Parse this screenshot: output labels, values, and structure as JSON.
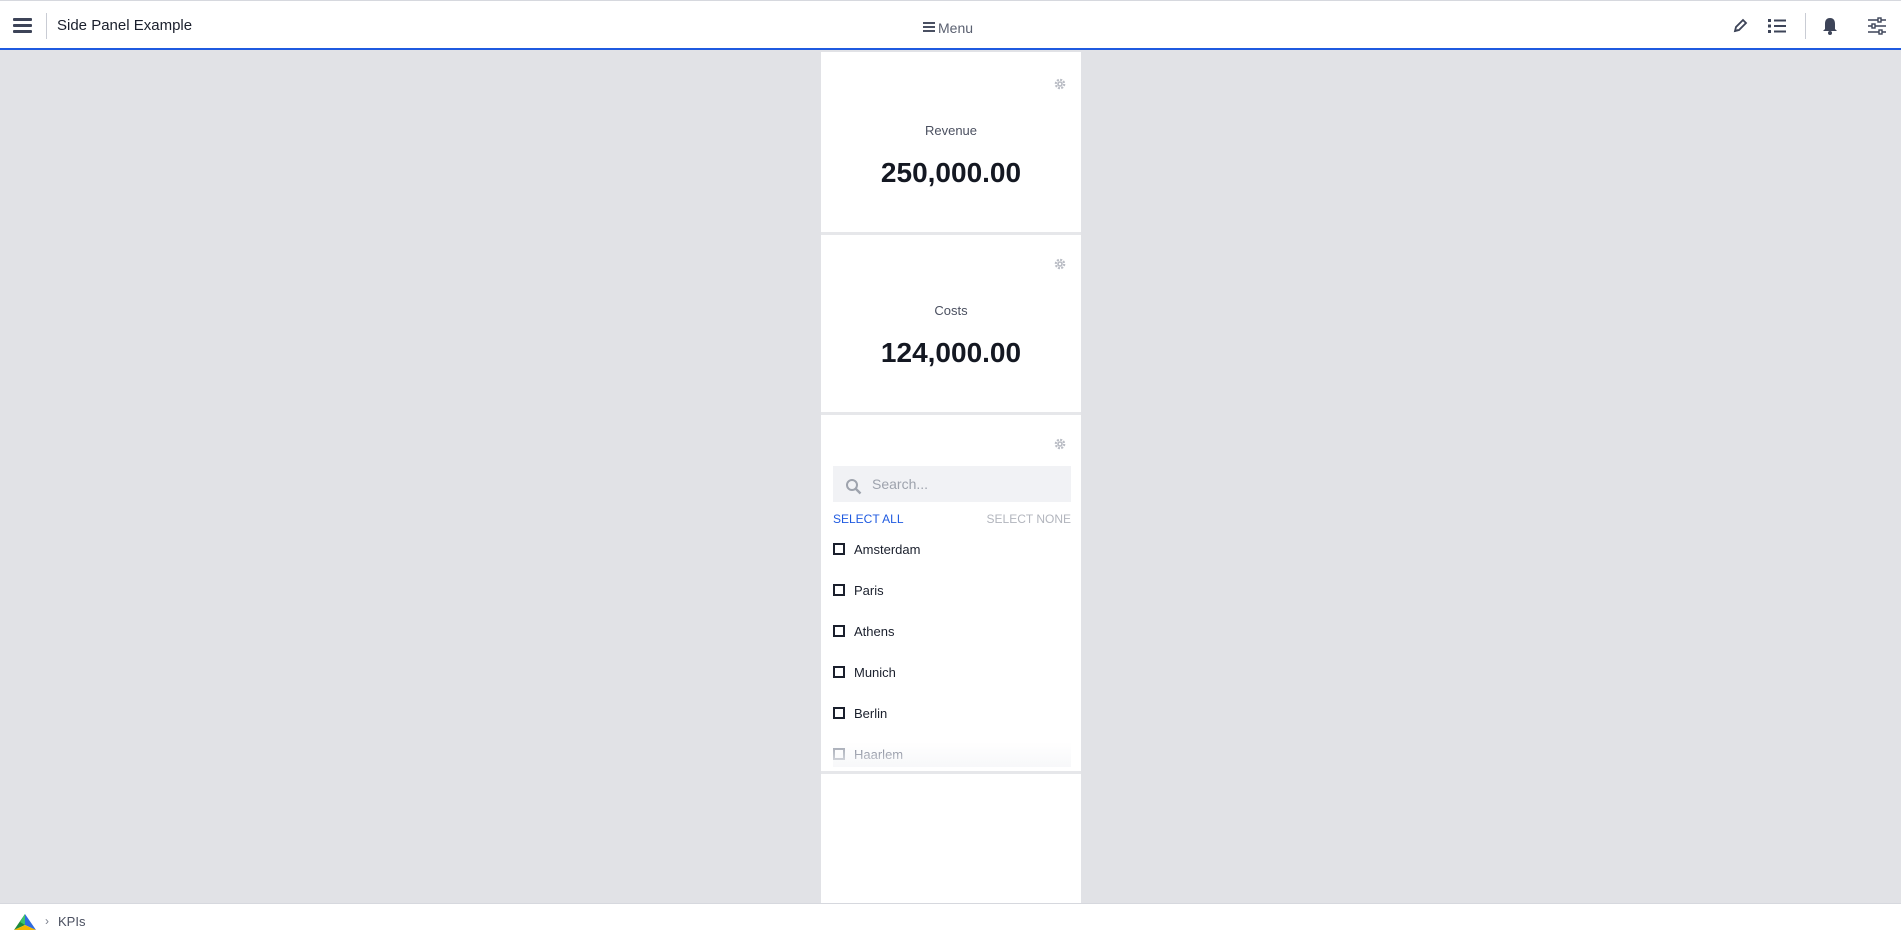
{
  "header": {
    "title": "Side Panel Example",
    "menu_label": "Menu",
    "icons": [
      "menu-icon",
      "pencil-icon",
      "list-icon",
      "bell-icon",
      "sliders-icon"
    ]
  },
  "kpis": [
    {
      "label": "Revenue",
      "value": "250,000.00"
    },
    {
      "label": "Costs",
      "value": "124,000.00"
    }
  ],
  "filter": {
    "search_placeholder": "Search...",
    "select_all": "SELECT ALL",
    "select_none": "SELECT NONE",
    "items": [
      {
        "label": "Amsterdam",
        "checked": false
      },
      {
        "label": "Paris",
        "checked": false
      },
      {
        "label": "Athens",
        "checked": false
      },
      {
        "label": "Munich",
        "checked": false
      },
      {
        "label": "Berlin",
        "checked": false
      },
      {
        "label": "Haarlem",
        "checked": false
      }
    ]
  },
  "breadcrumb": {
    "items": [
      "KPIs"
    ]
  },
  "colors": {
    "accent": "#1f5ae0",
    "background": "#e1e2e6",
    "panel": "#ffffff"
  }
}
